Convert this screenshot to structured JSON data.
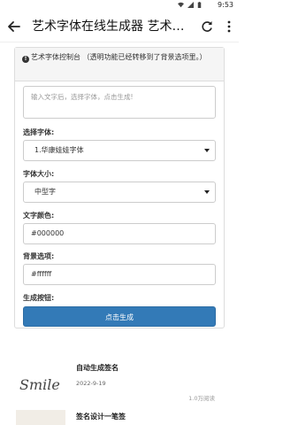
{
  "status_bar": {
    "time": "9:53"
  },
  "app_bar": {
    "title": "艺术字体在线生成器 艺术字..."
  },
  "panel": {
    "header_text": "艺术字体控制台 （透明功能已经转移到了背景选项里。）",
    "textarea_placeholder": "输入文字后，选择字体，点击生成!",
    "font_label": "选择字体:",
    "font_value": "1.华康娃娃字体",
    "size_label": "字体大小:",
    "size_value": "中型字",
    "color_label": "文字颜色:",
    "color_value": "#000000",
    "bg_label": "背景选项:",
    "bg_value": "#ffffff",
    "gen_label": "生成按钮:",
    "gen_button": "点击生成"
  },
  "articles": [
    {
      "title": "自动生成签名",
      "date": "2022-9-19",
      "views": "1.0万阅读",
      "thumb_text": "Smile"
    },
    {
      "title": "签名设计一笔签"
    }
  ],
  "colors": {
    "button": "#337ab7",
    "panel_head": "#f5f5f5",
    "border": "#dddddd"
  }
}
